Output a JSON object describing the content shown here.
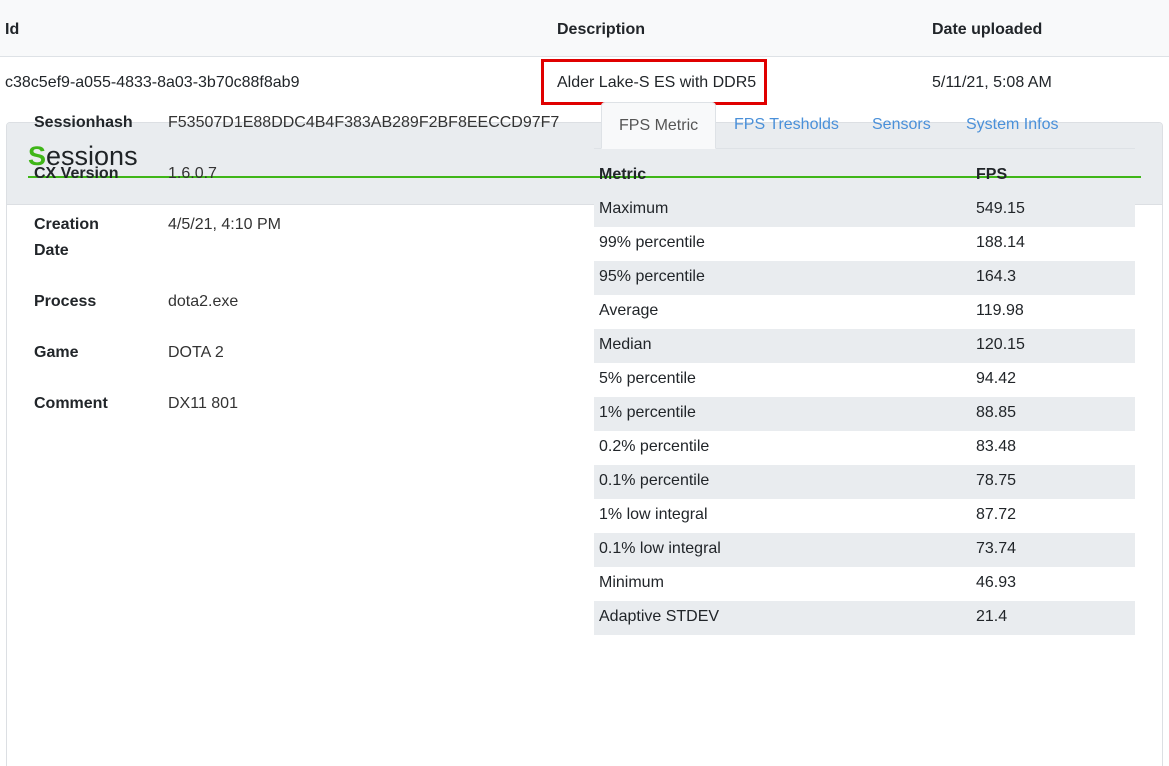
{
  "uploads_table": {
    "headers": {
      "id": "Id",
      "description": "Description",
      "date": "Date uploaded"
    },
    "row": {
      "id": "c38c5ef9-a055-4833-8a03-3b70c88f8ab9",
      "description": "Alder Lake-S ES with DDR5",
      "date": "5/11/21, 5:08 AM"
    }
  },
  "sessions": {
    "title_first": "S",
    "title_rest": "essions",
    "accent_color": "#3fb618",
    "info": [
      {
        "label": "Sessionhash",
        "value": "F53507D1E88DDC4B4F383AB289F2BF8EECCD97F7"
      },
      {
        "label": "CX Version",
        "value": "1.6.0.7"
      },
      {
        "label": "Creation Date",
        "value": "4/5/21, 4:10 PM"
      },
      {
        "label": "Process",
        "value": "dota2.exe"
      },
      {
        "label": "Game",
        "value": "DOTA 2"
      },
      {
        "label": "Comment",
        "value": "DX11 801"
      }
    ],
    "tabs": [
      {
        "label": "FPS Metric",
        "active": true
      },
      {
        "label": "FPS Tresholds",
        "active": false
      },
      {
        "label": "Sensors",
        "active": false
      },
      {
        "label": "System Infos",
        "active": false
      }
    ],
    "metrics": {
      "headers": {
        "metric": "Metric",
        "fps": "FPS"
      },
      "rows": [
        {
          "metric": "Maximum",
          "fps": "549.15"
        },
        {
          "metric": "99% percentile",
          "fps": "188.14"
        },
        {
          "metric": "95% percentile",
          "fps": "164.3"
        },
        {
          "metric": "Average",
          "fps": "119.98"
        },
        {
          "metric": "Median",
          "fps": "120.15"
        },
        {
          "metric": "5% percentile",
          "fps": "94.42"
        },
        {
          "metric": "1% percentile",
          "fps": "88.85"
        },
        {
          "metric": "0.2% percentile",
          "fps": "83.48"
        },
        {
          "metric": "0.1% percentile",
          "fps": "78.75"
        },
        {
          "metric": "1% low integral",
          "fps": "87.72"
        },
        {
          "metric": "0.1% low integral",
          "fps": "73.74"
        },
        {
          "metric": "Minimum",
          "fps": "46.93"
        },
        {
          "metric": "Adaptive STDEV",
          "fps": "21.4"
        }
      ]
    }
  }
}
